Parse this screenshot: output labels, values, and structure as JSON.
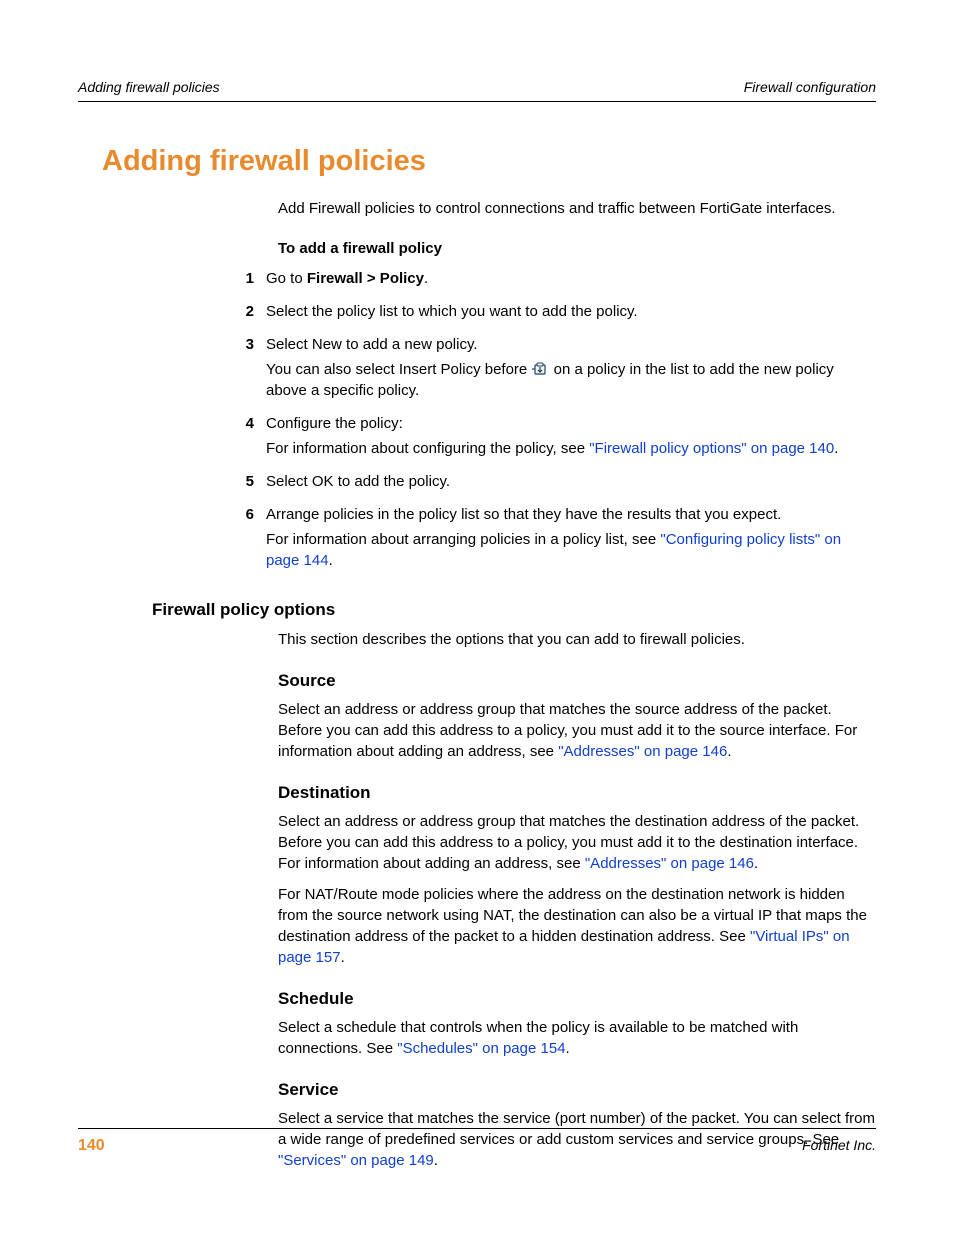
{
  "header": {
    "left": "Adding firewall policies",
    "right": "Firewall configuration"
  },
  "title": "Adding firewall policies",
  "intro": "Add Firewall policies to control connections and traffic between FortiGate interfaces.",
  "procedure_title": "To add a firewall policy",
  "steps": {
    "s1": {
      "num": "1",
      "a": "Go to ",
      "b": "Firewall > Policy",
      "c": "."
    },
    "s2": {
      "num": "2",
      "a": "Select the policy list to which you want to add the policy."
    },
    "s3": {
      "num": "3",
      "a": "Select New to add a new policy.",
      "b_pre": "You can also select Insert Policy before ",
      "b_post": " on a policy in the list to add the new policy above a specific policy."
    },
    "s4": {
      "num": "4",
      "a": "Configure the policy:",
      "b": "For information about configuring the policy, see ",
      "link": "\"Firewall policy options\" on page 140",
      "c": "."
    },
    "s5": {
      "num": "5",
      "a": "Select OK to add the policy."
    },
    "s6": {
      "num": "6",
      "a": "Arrange policies in the policy list so that they have the results that you expect.",
      "b": "For information about arranging policies in a policy list, see ",
      "link": "\"Configuring policy lists\" on page 144",
      "c": "."
    }
  },
  "subheading": "Firewall policy options",
  "subpara": "This section describes the options that you can add to firewall policies.",
  "source": {
    "h": "Source",
    "p1a": "Select an address or address group that matches the source address of the packet. Before you can add this address to a policy, you must add it to the source interface. For information about adding an address, see ",
    "p1link": "\"Addresses\" on page 146",
    "p1b": "."
  },
  "destination": {
    "h": "Destination",
    "p1a": "Select an address or address group that matches the destination address of the packet. Before you can add this address to a policy, you must add it to the destination interface. For information about adding an address, see ",
    "p1link": "\"Addresses\" on page 146",
    "p1b": ".",
    "p2a": "For NAT/Route mode policies where the address on the destination network is hidden from the source network using NAT, the destination can also be a virtual IP that maps the destination address of the packet to a hidden destination address. See ",
    "p2link": "\"Virtual IPs\" on page 157",
    "p2b": "."
  },
  "schedule": {
    "h": "Schedule",
    "p1a": "Select a schedule that controls when the policy is available to be matched with connections. See ",
    "p1link": "\"Schedules\" on page 154",
    "p1b": "."
  },
  "service": {
    "h": "Service",
    "p1a": "Select a service that matches the service (port number) of the packet. You can select from a wide range of predefined services or add custom services and service groups. See ",
    "p1link": "\"Services\" on page 149",
    "p1b": "."
  },
  "footer": {
    "page": "140",
    "brand": "Fortinet Inc."
  }
}
